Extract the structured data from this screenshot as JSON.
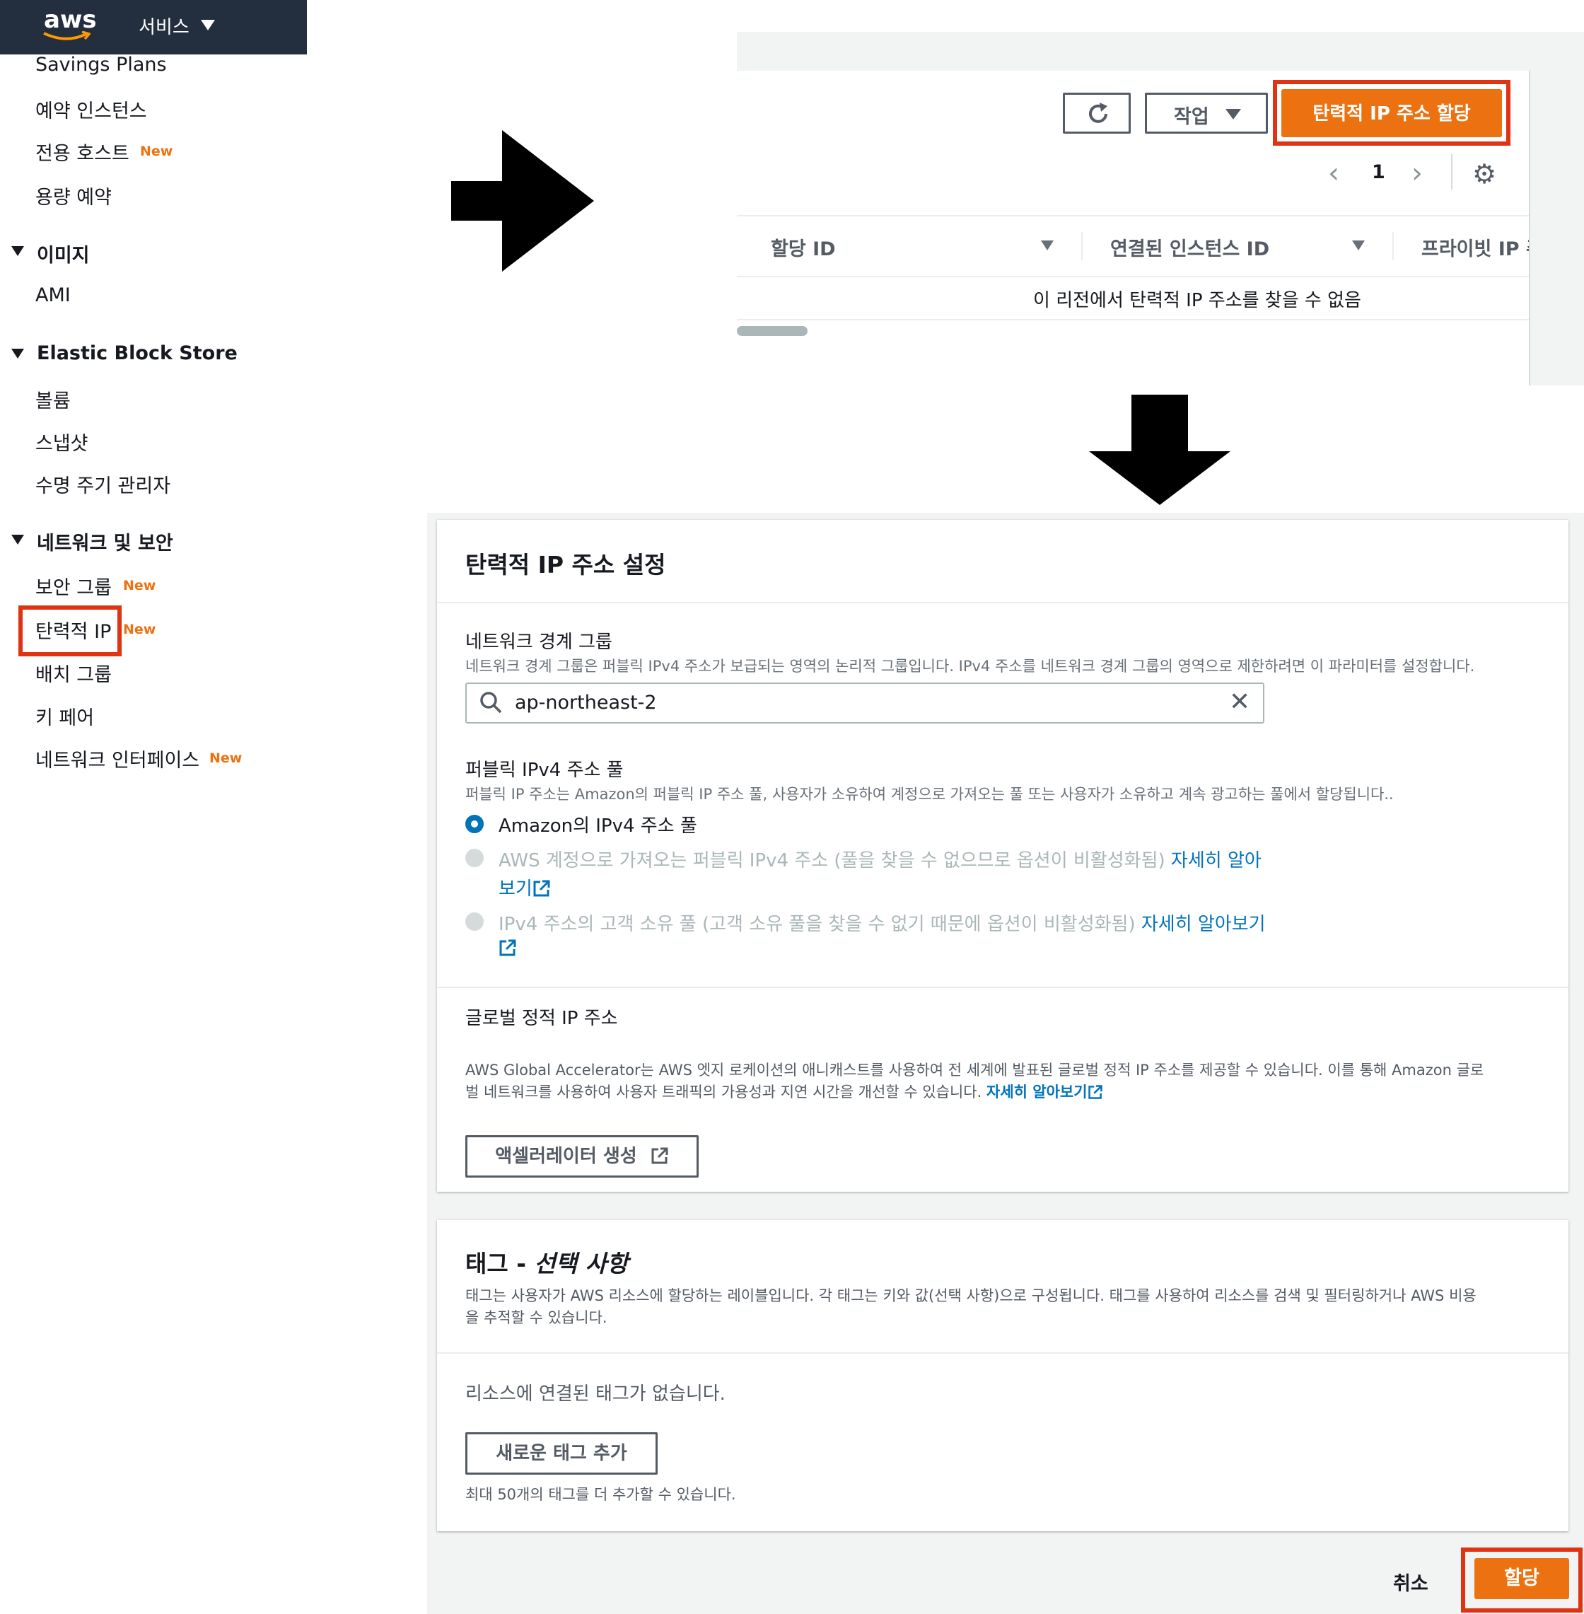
{
  "sidebar": {
    "logo": "aws",
    "services_label": "서비스",
    "items": [
      {
        "label": "Savings Plans"
      },
      {
        "label": "예약 인스턴스"
      },
      {
        "label": "전용 호스트",
        "badge": "New"
      },
      {
        "label": "용량 예약"
      }
    ],
    "sections": [
      {
        "title": "이미지",
        "items": [
          {
            "label": "AMI"
          }
        ]
      },
      {
        "title": "Elastic Block Store",
        "items": [
          {
            "label": "볼륨"
          },
          {
            "label": "스냅샷"
          },
          {
            "label": "수명 주기 관리자"
          }
        ]
      },
      {
        "title": "네트워크 및 보안",
        "items": [
          {
            "label": "보안 그룹",
            "badge": "New"
          },
          {
            "label": "탄력적 IP",
            "badge": "New",
            "highlighted": true
          },
          {
            "label": "배치 그룹"
          },
          {
            "label": "키 페어"
          },
          {
            "label": "네트워크 인터페이스",
            "badge": "New"
          }
        ]
      }
    ]
  },
  "list_view": {
    "actions_label": "작업",
    "allocate_button": "탄력적 IP 주소 할당",
    "page": "1",
    "columns": [
      "할당 ID",
      "연결된 인스턴스 ID",
      "프라이빗 IP 주"
    ],
    "empty_message": "이 리전에서 탄력적 IP 주소를 찾을 수 없음"
  },
  "settings": {
    "title": "탄력적 IP 주소 설정",
    "network_border_group": {
      "label": "네트워크 경계 그룹",
      "description": "네트워크 경계 그룹은 퍼블릭 IPv4 주소가 보급되는 영역의 논리적 그룹입니다. IPv4 주소를 네트워크 경계 그룹의 영역으로 제한하려면 이 파라미터를 설정합니다.",
      "value": "ap-northeast-2"
    },
    "ipv4_pool": {
      "label": "퍼블릭 IPv4 주소 풀",
      "description": "퍼블릭 IP 주소는 Amazon의 퍼블릭 IP 주소 풀, 사용자가 소유하여 계정으로 가져오는 풀 또는 사용자가 소유하고 계속 광고하는 풀에서 할당됩니다..",
      "options": [
        {
          "label": "Amazon의 IPv4 주소 풀",
          "selected": true
        },
        {
          "label_line1": "AWS 계정으로 가져오는 퍼블릭 IPv4 주소 (풀을 찾을 수 없으므로 옵션이 비활성화됨)",
          "link_line1": "자세히 알아",
          "link_line2": "보기"
        },
        {
          "label_line1": "IPv4 주소의 고객 소유 풀 (고객 소유 풀을 찾을 수 없기 때문에 옵션이 비활성화됨)",
          "link_line1": "자세히 알아보기"
        }
      ]
    },
    "global_static_ip": {
      "label": "글로벌 정적 IP 주소",
      "description_line1": "AWS Global Accelerator는 AWS 엣지 로케이션의 애니캐스트를 사용하여 전 세계에 발표된 글로벌 정적 IP 주소를 제공할 수 있습니다. 이를 통해 Amazon 글로",
      "description_line2": "벌 네트워크를 사용하여 사용자 트래픽의 가용성과 지연 시간을 개선할 수 있습니다.",
      "link": "자세히 알아보기",
      "button": "액셀러레이터 생성"
    }
  },
  "tags": {
    "title": "태그 - ",
    "title_optional": "선택 사항",
    "description_line1": "태그는 사용자가 AWS 리소스에 할당하는 레이블입니다. 각 태그는 키와 값(선택 사항)으로 구성됩니다. 태그를 사용하여 리소스를 검색 및 필터링하거나 AWS 비용",
    "description_line2": "을 추적할 수 있습니다.",
    "empty": "리소스에 연결된 태그가 없습니다.",
    "add_button": "새로운 태그 추가",
    "limit_note": "최대 50개의 태그를 더 추가할 수 있습니다."
  },
  "footer": {
    "cancel": "취소",
    "allocate": "할당"
  },
  "colors": {
    "accent": "#ec7211",
    "highlight": "#df3312",
    "link": "#0073bb",
    "header": "#232f3e"
  }
}
